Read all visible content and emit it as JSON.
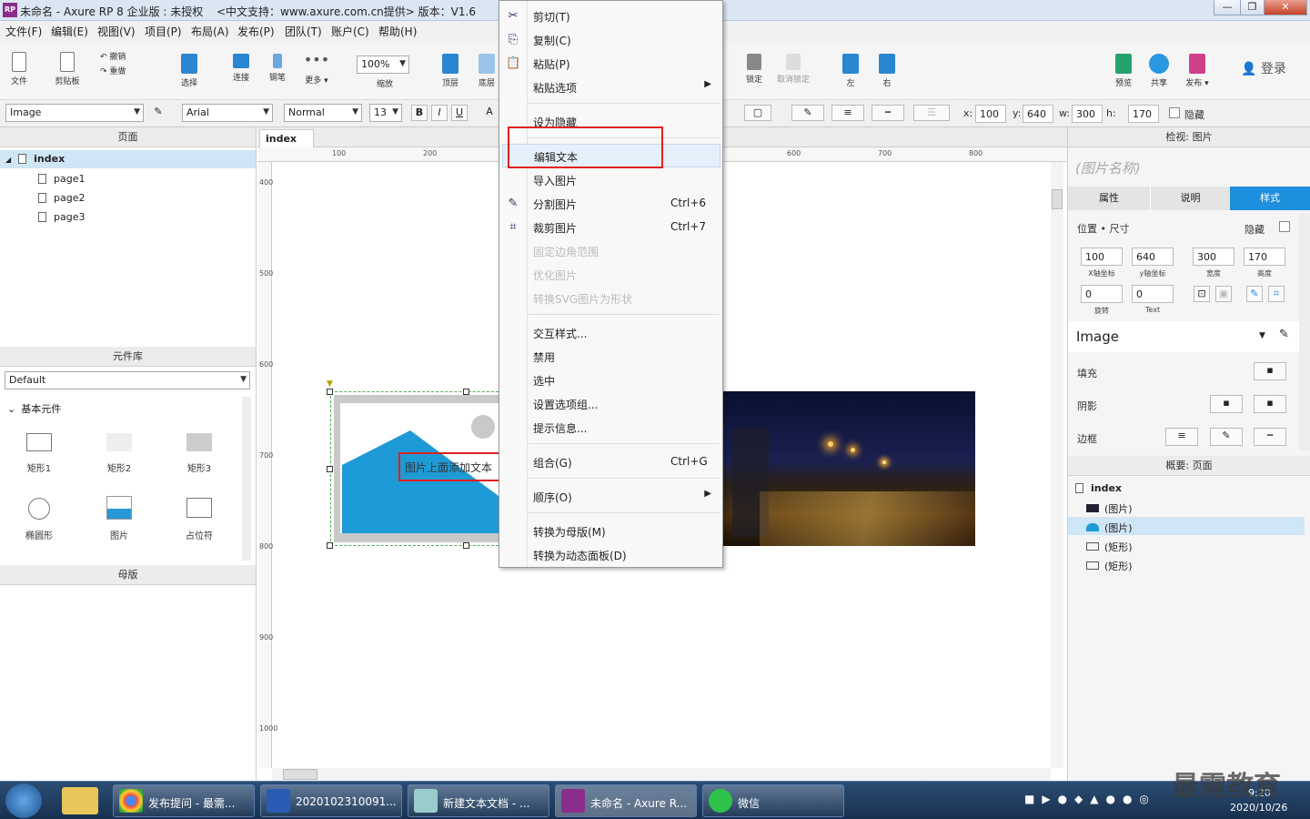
{
  "window": {
    "title": "未命名 - Axure RP 8 企业版 : 未授权",
    "title2": "<中文支持：www.axure.com.cn提供> 版本：V1.6",
    "app_badge": "RP",
    "min": "—",
    "max": "❐",
    "close": "✕"
  },
  "menus": [
    "文件(F)",
    "编辑(E)",
    "视图(V)",
    "项目(P)",
    "布局(A)",
    "发布(P)",
    "团队(T)",
    "账户(C)",
    "帮助(H)"
  ],
  "toolbar": {
    "file": "文件",
    "clipboard": "剪贴板",
    "undo": "撤销",
    "redo": "重做",
    "select": "选择",
    "connect": "连接",
    "pen": "钢笔",
    "more": "更多 ▾",
    "zoom": "100%",
    "zoom_label": "缩放",
    "top": "顶层",
    "bottom": "底层",
    "lock": "锁定",
    "unlock": "取消锁定",
    "left": "左",
    "right": "右",
    "preview": "预览",
    "share": "共享",
    "publish": "发布 ▾",
    "login": "登录"
  },
  "format": {
    "widget_style": "Image",
    "font": "Arial",
    "weight": "Normal",
    "size": "13",
    "bold": "B",
    "italic": "I",
    "underline": "U",
    "x_label": "x:",
    "x": "100",
    "y_label": "y:",
    "y": "640",
    "w_label": "w:",
    "w": "300",
    "h_label": "h:",
    "h": "170",
    "hidden": "隐藏"
  },
  "pages_panel": {
    "title": "页面",
    "root": "index",
    "pages": [
      "page1",
      "page2",
      "page3"
    ]
  },
  "library_panel": {
    "title": "元件库",
    "library": "Default",
    "group": "基本元件",
    "widgets": [
      "矩形1",
      "矩形2",
      "矩形3",
      "椭圆形",
      "图片",
      "占位符"
    ]
  },
  "masters_panel": {
    "title": "母版"
  },
  "canvas": {
    "tab": "index",
    "tab_close": "×",
    "ruler_x": [
      "100",
      "200",
      "600",
      "700",
      "800"
    ],
    "ruler_y": [
      "400",
      "500",
      "600",
      "700",
      "800",
      "900",
      "1000"
    ],
    "image_text": "图片上面添加文本"
  },
  "context_menu": {
    "items": [
      {
        "label": "剪切(T)",
        "shortcut": "",
        "icon": "scissors-icon"
      },
      {
        "label": "复制(C)",
        "shortcut": "",
        "icon": "copy-icon"
      },
      {
        "label": "粘贴(P)",
        "shortcut": "",
        "icon": "paste-icon"
      },
      {
        "label": "粘贴选项",
        "shortcut": "",
        "icon": ""
      },
      {
        "label": "设为隐藏",
        "shortcut": "",
        "icon": ""
      },
      {
        "label": "编辑文本",
        "shortcut": "",
        "icon": ""
      },
      {
        "label": "导入图片",
        "shortcut": "",
        "icon": ""
      },
      {
        "label": "分割图片",
        "shortcut": "Ctrl+6",
        "icon": "slice-icon"
      },
      {
        "label": "裁剪图片",
        "shortcut": "Ctrl+7",
        "icon": "crop-icon"
      },
      {
        "label": "固定边角范围",
        "shortcut": "",
        "icon": ""
      },
      {
        "label": "优化图片",
        "shortcut": "",
        "icon": ""
      },
      {
        "label": "转换SVG图片为形状",
        "shortcut": "",
        "icon": ""
      },
      {
        "label": "交互样式...",
        "shortcut": "",
        "icon": ""
      },
      {
        "label": "禁用",
        "shortcut": "",
        "icon": ""
      },
      {
        "label": "选中",
        "shortcut": "",
        "icon": ""
      },
      {
        "label": "设置选项组...",
        "shortcut": "",
        "icon": ""
      },
      {
        "label": "提示信息...",
        "shortcut": "",
        "icon": ""
      },
      {
        "label": "组合(G)",
        "shortcut": "Ctrl+G",
        "icon": ""
      },
      {
        "label": "顺序(O)",
        "shortcut": "",
        "icon": ""
      },
      {
        "label": "转换为母版(M)",
        "shortcut": "",
        "icon": ""
      },
      {
        "label": "转换为动态面板(D)",
        "shortcut": "",
        "icon": ""
      }
    ],
    "submenu_arrow": "▶"
  },
  "inspector": {
    "title": "检视: 图片",
    "name_placeholder": "(图片名称)",
    "tabs": [
      "属性",
      "说明",
      "样式"
    ],
    "pos_size": "位置 • 尺寸",
    "hidden": "隐藏",
    "x": "100",
    "y": "640",
    "w": "300",
    "h": "170",
    "x_lbl": "X轴坐标",
    "y_lbl": "y轴坐标",
    "w_lbl": "宽度",
    "h_lbl": "高度",
    "rot": "0",
    "rot_lbl": "旋转",
    "text_rot": "0",
    "text_lbl": "Text",
    "style": "Image",
    "fill": "填充",
    "shadow": "阴影",
    "border": "边框"
  },
  "outline": {
    "title": "概要: 页面",
    "root": "index",
    "items": [
      "(图片)",
      "(图片)",
      "(矩形)",
      "(矩形)"
    ]
  },
  "taskbar": {
    "tasks": [
      "发布提问 - 最需...",
      "2020102310091...",
      "新建文本文档 - ...",
      "未命名 - Axure R...",
      "微信"
    ],
    "time": "9:20",
    "date": "2020/10/26",
    "watermark": "最需教育"
  }
}
